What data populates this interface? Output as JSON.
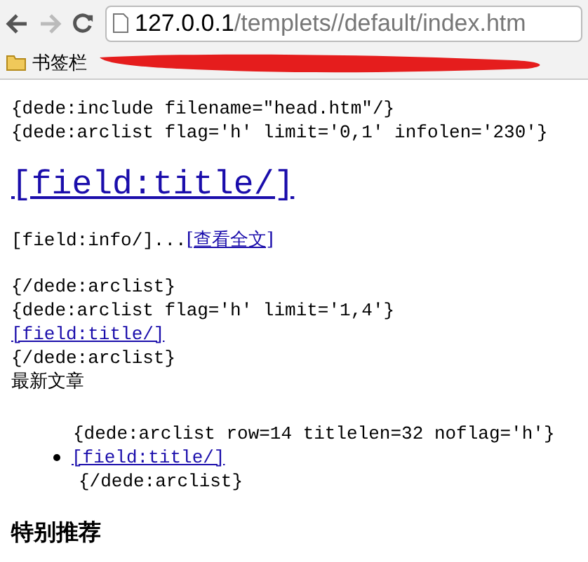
{
  "toolbar": {
    "url_host": "127.0.0.1",
    "url_path": "/templets//default/index.htm"
  },
  "bookmarks_bar": {
    "folder_label": "书签栏"
  },
  "content": [
    {
      "kind": "code",
      "text": "{dede:include filename=\"head.htm\"/}"
    },
    {
      "kind": "code",
      "text": "{dede:arclist flag='h' limit='0,1' infolen='230'}"
    },
    {
      "kind": "heading-link",
      "text": "[field:title/]"
    },
    {
      "kind": "info",
      "text": "[field:info/]...",
      "link": "[查看全文]"
    },
    {
      "kind": "code",
      "text": "{/dede:arclist}"
    },
    {
      "kind": "code",
      "text": "{dede:arclist flag='h' limit='1,4'}"
    },
    {
      "kind": "link",
      "text": "[field:title/]"
    },
    {
      "kind": "code",
      "text": "{/dede:arclist}"
    },
    {
      "kind": "label",
      "text": "最新文章"
    },
    {
      "kind": "code-indent",
      "text": "{dede:arclist row=14 titlelen=32 noflag='h'}"
    },
    {
      "kind": "bullet-link",
      "text": "[field:title/]"
    },
    {
      "kind": "code-indent-small",
      "text": "{/dede:arclist}"
    },
    {
      "kind": "bold-heading",
      "text": "特别推荐"
    }
  ]
}
